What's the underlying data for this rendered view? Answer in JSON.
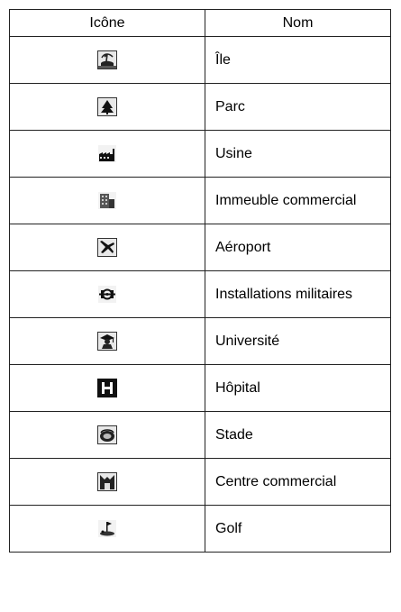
{
  "table": {
    "headers": {
      "icon": "Icône",
      "name": "Nom"
    },
    "rows": [
      {
        "icon": "island-icon",
        "name": "Île"
      },
      {
        "icon": "park-tree-icon",
        "name": "Parc"
      },
      {
        "icon": "factory-icon",
        "name": "Usine"
      },
      {
        "icon": "commercial-building-icon",
        "name": "Immeuble commercial"
      },
      {
        "icon": "airplane-icon",
        "name": "Aéroport"
      },
      {
        "icon": "military-icon",
        "name": "Installations militaires"
      },
      {
        "icon": "university-icon",
        "name": "Université"
      },
      {
        "icon": "hospital-h-icon",
        "name": "Hôpital"
      },
      {
        "icon": "stadium-icon",
        "name": "Stade"
      },
      {
        "icon": "shopping-center-icon",
        "name": "Centre commercial"
      },
      {
        "icon": "golf-icon",
        "name": "Golf"
      }
    ]
  }
}
